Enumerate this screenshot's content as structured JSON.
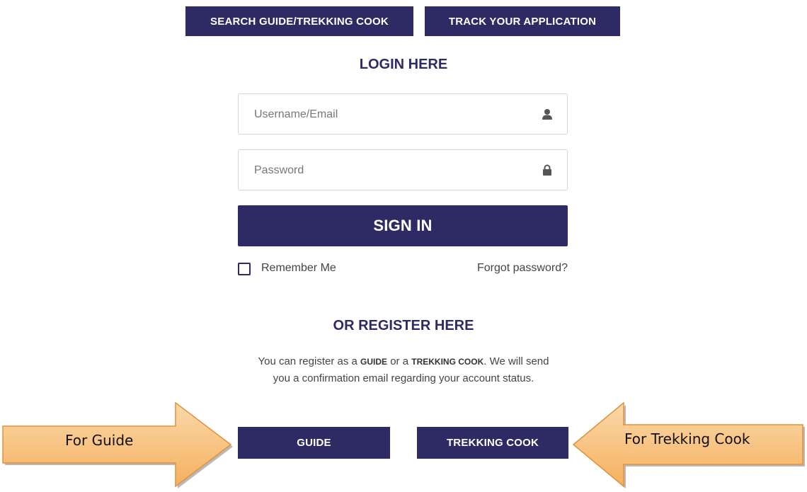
{
  "top_nav": {
    "search_label": "SEARCH GUIDE/TREKKING COOK",
    "track_label": "TRACK YOUR APPLICATION"
  },
  "login": {
    "heading": "LOGIN HERE",
    "username_placeholder": "Username/Email",
    "password_placeholder": "Password",
    "signin_label": "SIGN IN",
    "remember_label": "Remember Me",
    "forgot_label": "Forgot password?",
    "icons": {
      "username": "user-icon",
      "password": "lock-icon"
    }
  },
  "register": {
    "heading": "OR REGISTER HERE",
    "desc_part1": "You can register as a ",
    "desc_guide": "GUIDE",
    "desc_part2": " or a ",
    "desc_cook": "TREKKING COOK",
    "desc_part3": ". We will send you a confirmation email regarding your account status.",
    "guide_label": "GUIDE",
    "cook_label": "TREKKING COOK"
  },
  "callouts": {
    "left_text": "For Guide",
    "right_text": "For Trekking Cook"
  },
  "colors": {
    "brand": "#2e2a63",
    "callout_fill": "#f8c27c",
    "callout_stroke": "#e3913b"
  }
}
